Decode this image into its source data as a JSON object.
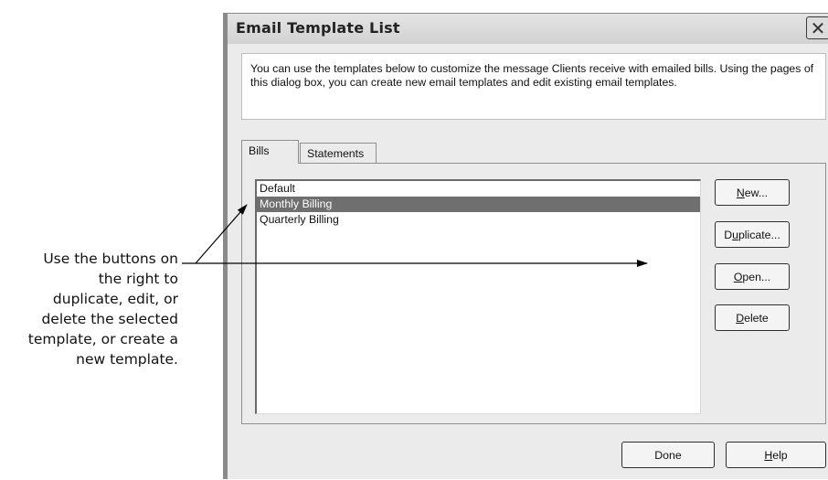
{
  "callout": {
    "lines": [
      "Use the buttons on",
      "the right to",
      "duplicate, edit, or",
      "delete the selected",
      "template, or create a",
      "new template."
    ]
  },
  "window": {
    "title": "Email Template List",
    "close_icon": "close-icon"
  },
  "description": "You can use the templates below to customize the message Clients receive with emailed bills. Using the pages of this dialog box, you can create new email templates and edit existing email templates.",
  "tabs": [
    {
      "label": "Bills",
      "active": true
    },
    {
      "label": "Statements",
      "active": false
    }
  ],
  "templates": {
    "items": [
      "Default",
      "Monthly Billing",
      "Quarterly Billing"
    ],
    "selected": "Monthly Billing"
  },
  "buttons": {
    "new": {
      "label": "New...",
      "mnemonic": "N"
    },
    "duplicate": {
      "label": "Duplicate...",
      "mnemonic": "u"
    },
    "open": {
      "label": "Open...",
      "mnemonic": "O"
    },
    "delete": {
      "label": "Delete",
      "mnemonic": "D"
    },
    "done": {
      "label": "Done"
    },
    "help": {
      "label": "Help",
      "mnemonic": "H"
    }
  }
}
